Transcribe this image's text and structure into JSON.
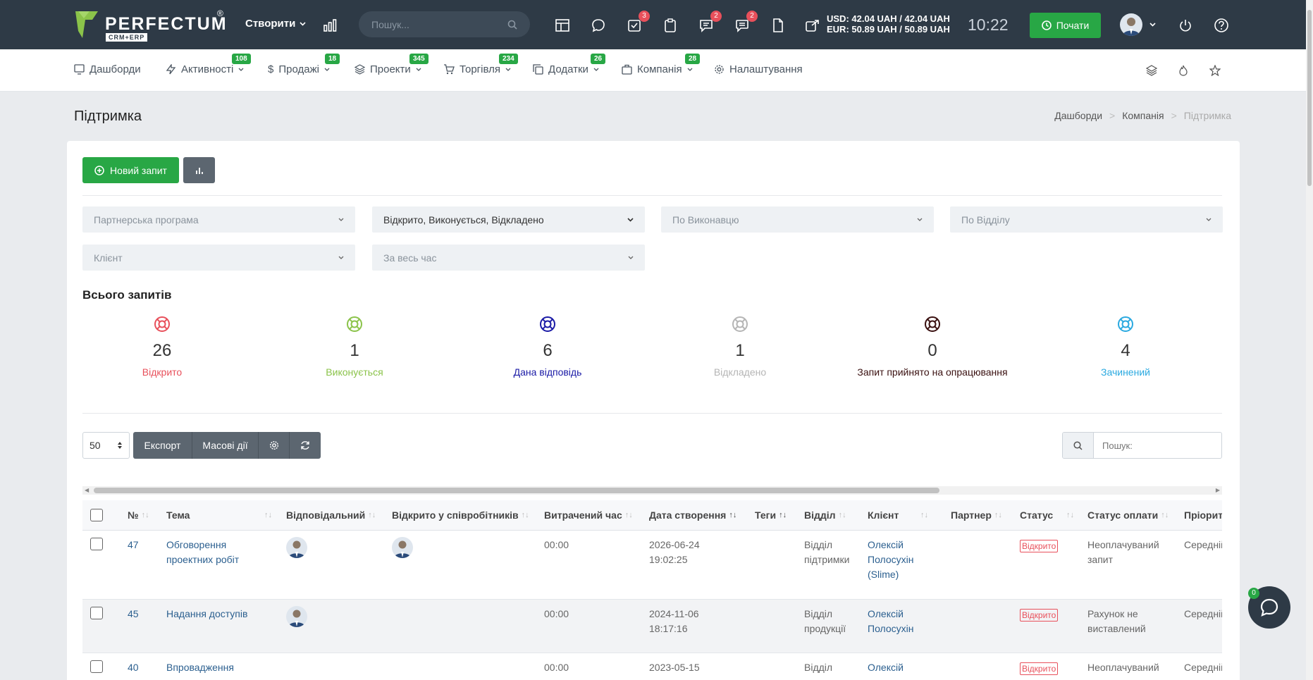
{
  "brand": {
    "name": "PERFECTUM",
    "reg": "®",
    "sub": "CRM+ERP"
  },
  "topbar": {
    "create_label": "Створити",
    "search_placeholder": "Пошук...",
    "badges": {
      "tasks": "3",
      "chat": "2",
      "messages": "2"
    },
    "currency_usd": "USD: 42.04 UAH / 42.04 UAH",
    "currency_eur": "EUR: 50.89 UAH / 50.89 UAH",
    "clock": "10:22",
    "start_label": "Почати"
  },
  "nav": {
    "items": [
      {
        "label": "Дашборди",
        "badge": ""
      },
      {
        "label": "Активності",
        "badge": "108"
      },
      {
        "label": "Продажі",
        "badge": "18"
      },
      {
        "label": "Проекти",
        "badge": "345"
      },
      {
        "label": "Торгівля",
        "badge": "234"
      },
      {
        "label": "Додатки",
        "badge": "26"
      },
      {
        "label": "Компанія",
        "badge": "28"
      },
      {
        "label": "Налаштування",
        "badge": ""
      }
    ]
  },
  "page": {
    "title": "Підтримка",
    "breadcrumb": [
      "Дашборди",
      "Компанія",
      "Підтримка"
    ]
  },
  "actions": {
    "new_request": "Новий запит"
  },
  "filters": {
    "partner": "Партнерська програма",
    "status": "Відкрито, Виконується, Відкладено",
    "executor": "По Виконавцю",
    "department": "По Відділу",
    "client": "Клієнт",
    "period": "За весь час"
  },
  "totals": {
    "title": "Всього запитів",
    "stats": [
      {
        "count": "26",
        "label": "Відкрито",
        "color": "#e8505b"
      },
      {
        "count": "1",
        "label": "Виконується",
        "color": "#8bc34a"
      },
      {
        "count": "6",
        "label": "Дана відповідь",
        "color": "#1a1aa6"
      },
      {
        "count": "1",
        "label": "Відкладено",
        "color": "#b5b5b5"
      },
      {
        "count": "0",
        "label": "Запит прийнято на опрацювання",
        "color": "#3a1010"
      },
      {
        "count": "4",
        "label": "Зачинений",
        "color": "#2aa9e0"
      }
    ]
  },
  "toolbar": {
    "per_page": "50",
    "export": "Експорт",
    "bulk": "Масові дії",
    "search_placeholder": "Пошук:"
  },
  "table": {
    "headers": [
      "№",
      "Тема",
      "Відповідальний",
      "Відкрито у співробітників",
      "Витрачений час",
      "Дата створення",
      "Теги",
      "Відділ",
      "Клієнт",
      "Партнер",
      "Статус",
      "Статус оплати",
      "Пріорите"
    ],
    "rows": [
      {
        "id": "47",
        "topic": [
          "Обговорення",
          "проектних робіт"
        ],
        "time": "00:00",
        "date": [
          "2026-06-24",
          "19:02:25"
        ],
        "dept": [
          "Відділ",
          "підтримки"
        ],
        "client": [
          "Олексій",
          "Полосухін",
          "(Slime)"
        ],
        "status": "Відкрито",
        "payment": [
          "Неоплачуваний",
          "запит"
        ],
        "priority": "Середній"
      },
      {
        "id": "45",
        "topic": [
          "Надання доступів"
        ],
        "time": "00:00",
        "date": [
          "2024-11-06",
          "18:17:16"
        ],
        "dept": [
          "Відділ",
          "продукції"
        ],
        "client": [
          "Олексій",
          "Полосухін"
        ],
        "status": "Відкрито",
        "payment": [
          "Рахунок не",
          "виставлений"
        ],
        "priority": "Середній"
      },
      {
        "id": "40",
        "topic": [
          "Впровадження"
        ],
        "time": "00:00",
        "date": [
          "2023-05-15"
        ],
        "dept": [
          "Відділ"
        ],
        "client": [
          "Олексій"
        ],
        "status": "Відкрито",
        "payment": [
          "Неоплачуваний"
        ],
        "priority": "Середній"
      }
    ]
  },
  "chat": {
    "badge": "0"
  }
}
